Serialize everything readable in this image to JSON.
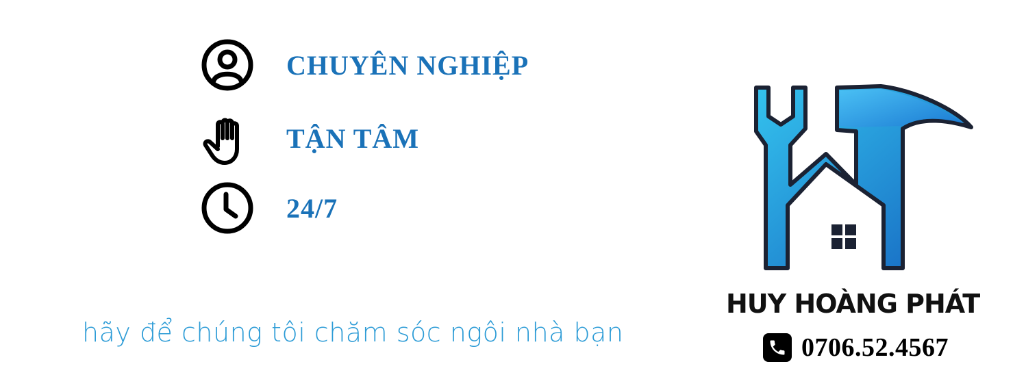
{
  "colors": {
    "accent": "#1a72b8",
    "tagline": "#2b9bd6",
    "logo_light": "#34c3ee",
    "logo_dark": "#1565c0",
    "logo_outline": "#1b2233",
    "icon": "#000000"
  },
  "features": [
    {
      "icon": "user-circle-icon",
      "label": "CHUYÊN NGHIỆP"
    },
    {
      "icon": "hand-icon",
      "label": "TẬN TÂM"
    },
    {
      "icon": "clock-icon",
      "label": "24/7"
    }
  ],
  "tagline": "hãy để chúng tôi chăm sóc ngôi nhà bạn",
  "brand": {
    "logo": "house-tools-logo",
    "name": "HUY HOÀNG PHÁT",
    "phone_icon": "phone-icon",
    "phone": "0706.52.4567"
  }
}
